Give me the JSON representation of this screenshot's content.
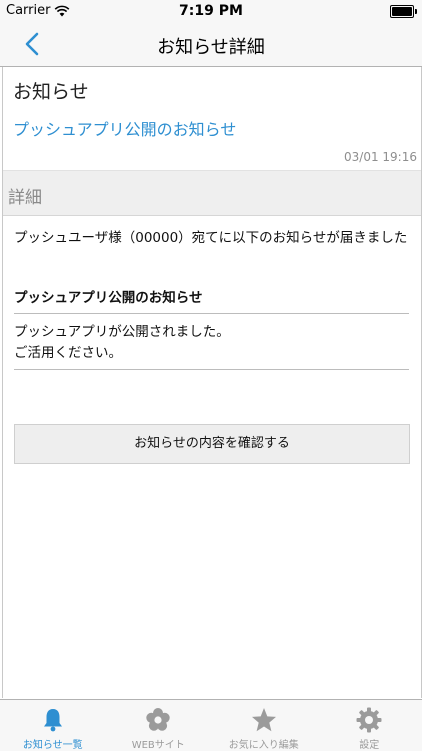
{
  "status_bar": {
    "carrier": "Carrier",
    "time": "7:19 PM",
    "battery_level": 1.0
  },
  "nav": {
    "title": "お知らせ詳細",
    "back_icon": "chevron-left-icon"
  },
  "notice": {
    "heading": "お知らせ",
    "title": "プッシュアプリ公開のお知らせ",
    "date": "03/01 19:16"
  },
  "detail": {
    "section_label": "詳細",
    "intro": "プッシュユーザ様（00000）宛てに以下のお知らせが届きました",
    "subject": "プッシュアプリ公開のお知らせ",
    "body_line1": "プッシュアプリが公開されました。",
    "body_line2": "ご活用ください。",
    "confirm_button": "お知らせの内容を確認する"
  },
  "tabs": [
    {
      "label": "お知らせ一覧",
      "icon": "bell-icon",
      "active": true
    },
    {
      "label": "WEBサイト",
      "icon": "flower-icon",
      "active": false
    },
    {
      "label": "お気に入り編集",
      "icon": "star-icon",
      "active": false
    },
    {
      "label": "設定",
      "icon": "gear-icon",
      "active": false
    }
  ],
  "colors": {
    "accent": "#2e8fd1",
    "inactive_tab": "#9b9b9b",
    "section_bg": "#efefef"
  }
}
